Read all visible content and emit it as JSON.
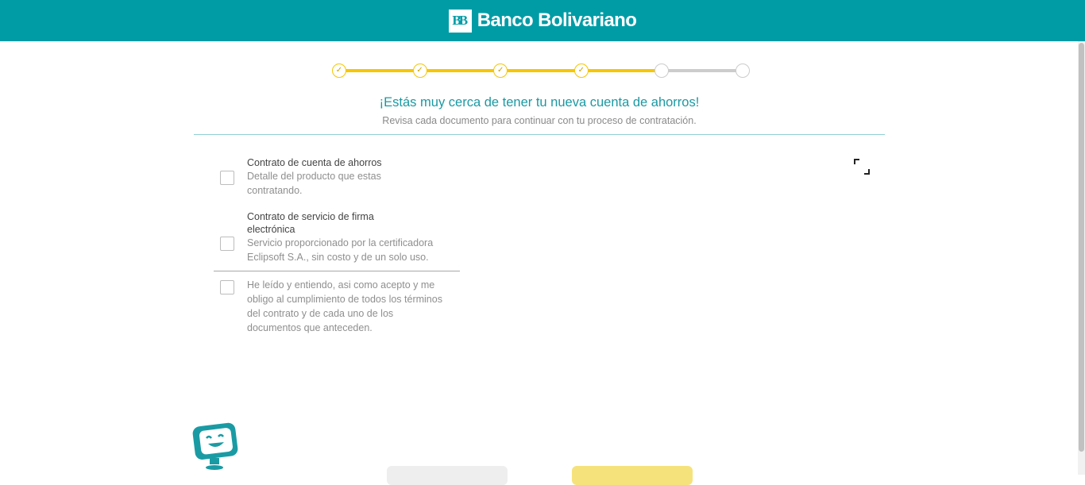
{
  "header": {
    "logo_mark": "BB",
    "brand_name": "Banco Bolivariano",
    "color": "#009ca6"
  },
  "stepper": {
    "total_steps": 6,
    "completed_steps": 4,
    "check_glyph": "✓",
    "active_color": "#f7c600",
    "pending_color": "#cccccc"
  },
  "page": {
    "title": "¡Estás muy cerca de tener tu nueva cuenta de ahorros!",
    "subtitle": "Revisa cada documento para continuar con tu proceso de contratación."
  },
  "documents": [
    {
      "title": "Contrato de cuenta de ahorros",
      "description": "Detalle del producto que estas contratando.",
      "checked": false
    },
    {
      "title": "Contrato de servicio de firma electrónica",
      "description": "Servicio proporcionado por la certificadora Eclipsoft S.A., sin costo y de un solo uso.",
      "checked": false
    }
  ],
  "acceptance": {
    "text": "He leído y entiendo, asi como acepto y me obligo al cumplimiento de todos los términos del contrato y de cada uno de los documentos que anteceden.",
    "checked": false
  },
  "icons": {
    "expand": "expand-icon",
    "mascot": "mascot-icon",
    "brand_logo": "bb-logo-icon"
  },
  "buttons": {
    "back_label": "",
    "continue_label": ""
  }
}
